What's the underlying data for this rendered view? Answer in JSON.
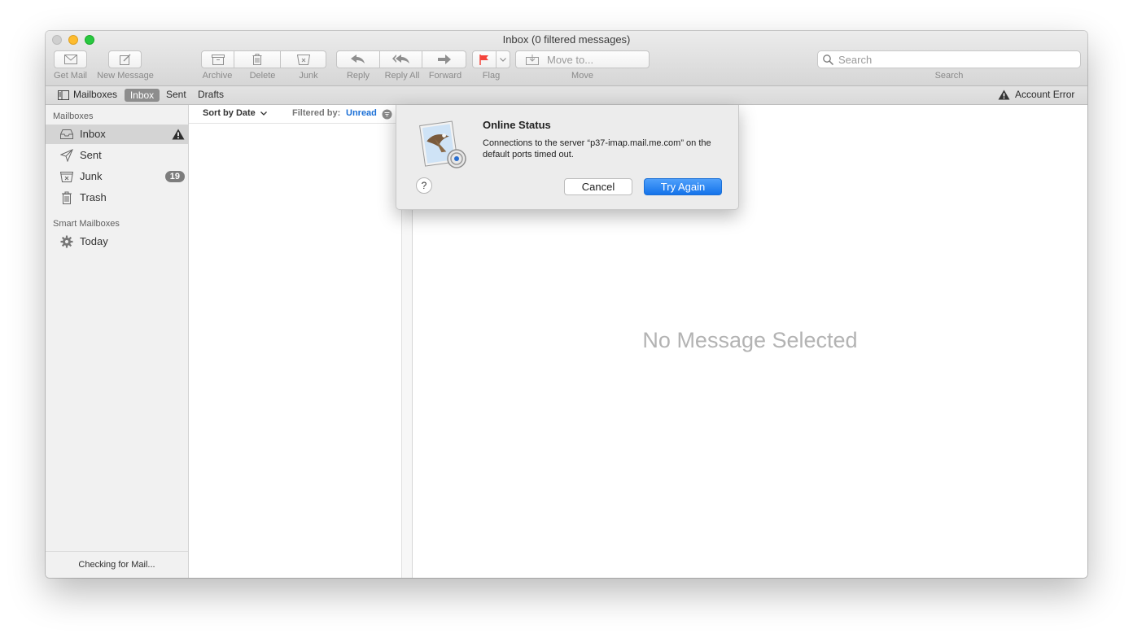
{
  "window": {
    "title": "Inbox (0 filtered messages)"
  },
  "toolbar": {
    "get_mail": "Get Mail",
    "new_message": "New Message",
    "archive": "Archive",
    "delete": "Delete",
    "junk": "Junk",
    "reply": "Reply",
    "reply_all": "Reply All",
    "forward": "Forward",
    "flag": "Flag",
    "move": "Move",
    "move_to_placeholder": "Move to...",
    "search_label": "Search",
    "search_placeholder": "Search",
    "flag_color": "#f4443b"
  },
  "favorites": {
    "mailboxes": "Mailboxes",
    "inbox": "Inbox",
    "sent": "Sent",
    "drafts": "Drafts",
    "account_error": "Account Error"
  },
  "sidebar": {
    "mailboxes_header": "Mailboxes",
    "items": [
      {
        "label": "Inbox",
        "icon": "inbox-icon"
      },
      {
        "label": "Sent",
        "icon": "paper-plane-icon"
      },
      {
        "label": "Junk",
        "icon": "junk-tray-icon",
        "badge": "19"
      },
      {
        "label": "Trash",
        "icon": "trash-icon"
      }
    ],
    "smart_header": "Smart Mailboxes",
    "smart_items": [
      {
        "label": "Today",
        "icon": "gear-icon"
      }
    ],
    "status": "Checking for Mail..."
  },
  "message_list": {
    "sort_label": "Sort by Date",
    "filtered_by_label": "Filtered by:",
    "filter_value": "Unread",
    "filter_color": "#1a6fd6"
  },
  "preview": {
    "empty_text": "No Message Selected"
  },
  "dialog": {
    "title": "Online Status",
    "message": "Connections to the server “p37-imap.mail.me.com” on the default ports timed out.",
    "help": "?",
    "cancel": "Cancel",
    "try_again": "Try Again"
  }
}
